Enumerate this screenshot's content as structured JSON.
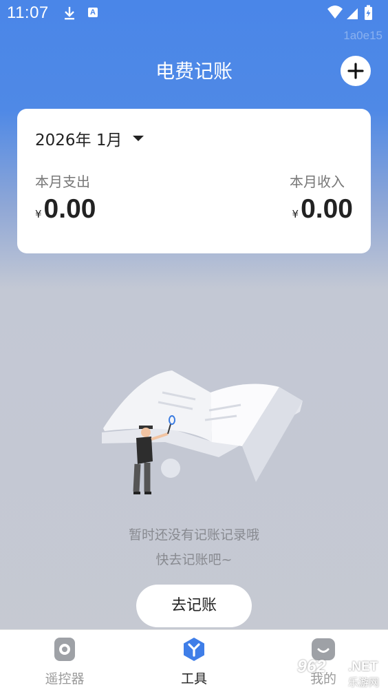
{
  "status_bar": {
    "time": "11:07",
    "icons": [
      "download-icon",
      "app-a-icon",
      "wifi-icon",
      "signal-icon",
      "battery-charging-icon"
    ],
    "overlay_id": "1a0e15"
  },
  "header": {
    "title": "电费记账",
    "add_icon": "plus-icon"
  },
  "summary": {
    "month": "2026年 1月",
    "expense_label": "本月支出",
    "income_label": "本月收入",
    "currency": "¥",
    "expense_value": "0.00",
    "income_value": "0.00"
  },
  "empty_state": {
    "line1": "暂时还没有记账记录哦",
    "line2": "快去记账吧~",
    "button": "去记账"
  },
  "tabs": [
    {
      "label": "遥控器",
      "icon": "remote-icon",
      "active": false
    },
    {
      "label": "工具",
      "icon": "tools-icon",
      "active": true
    },
    {
      "label": "我的",
      "icon": "profile-icon",
      "active": false
    }
  ],
  "watermark": {
    "number": "962",
    "suffix": ".NET",
    "text": "乐游网"
  },
  "colors": {
    "header_blue": "#4a86e8",
    "tab_active": "#3f7ee8",
    "background_gray": "#c6c9d2"
  }
}
